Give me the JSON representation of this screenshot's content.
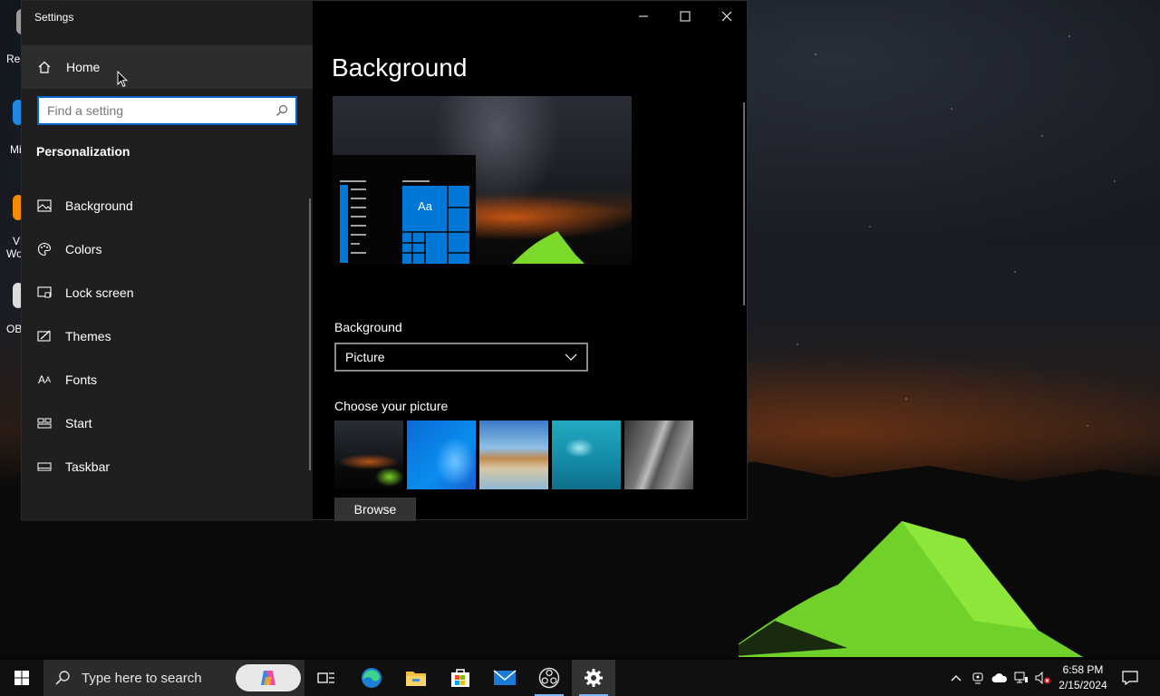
{
  "desktop": {
    "icons": [
      {
        "label": "Rec",
        "icon": "recycle-bin-icon",
        "color": "#c0c0c0"
      },
      {
        "label": "Mi",
        "icon": "edge-icon",
        "color": "#1e88e5"
      },
      {
        "label": "VL",
        "icon": "vlc-icon",
        "color": "#f28c00",
        "label2": "Wo"
      },
      {
        "label": "OB",
        "icon": "obs-icon",
        "color": "#e0e0e0"
      }
    ]
  },
  "window": {
    "title": "Settings",
    "controls": {
      "minimize": "minimize-icon",
      "maximize": "maximize-icon",
      "close": "close-icon"
    }
  },
  "sidebar": {
    "home_label": "Home",
    "search_placeholder": "Find a setting",
    "section_title": "Personalization",
    "items": [
      {
        "label": "Background",
        "icon": "picture-icon"
      },
      {
        "label": "Colors",
        "icon": "palette-icon"
      },
      {
        "label": "Lock screen",
        "icon": "lock-screen-icon"
      },
      {
        "label": "Themes",
        "icon": "themes-icon"
      },
      {
        "label": "Fonts",
        "icon": "fonts-icon"
      },
      {
        "label": "Start",
        "icon": "start-icon"
      },
      {
        "label": "Taskbar",
        "icon": "taskbar-icon"
      }
    ]
  },
  "content": {
    "title": "Background",
    "preview_tile_text": "Aa",
    "background_label": "Background",
    "background_value": "Picture",
    "choose_label": "Choose your picture",
    "browse_label": "Browse",
    "accent": "#0078d7"
  },
  "taskbar": {
    "search_placeholder": "Type here to search",
    "apps": [
      "task-view-icon",
      "edge-icon",
      "file-explorer-icon",
      "store-icon",
      "mail-icon",
      "obs-icon",
      "settings-icon"
    ],
    "time": "6:58 PM",
    "date": "2/15/2024"
  }
}
